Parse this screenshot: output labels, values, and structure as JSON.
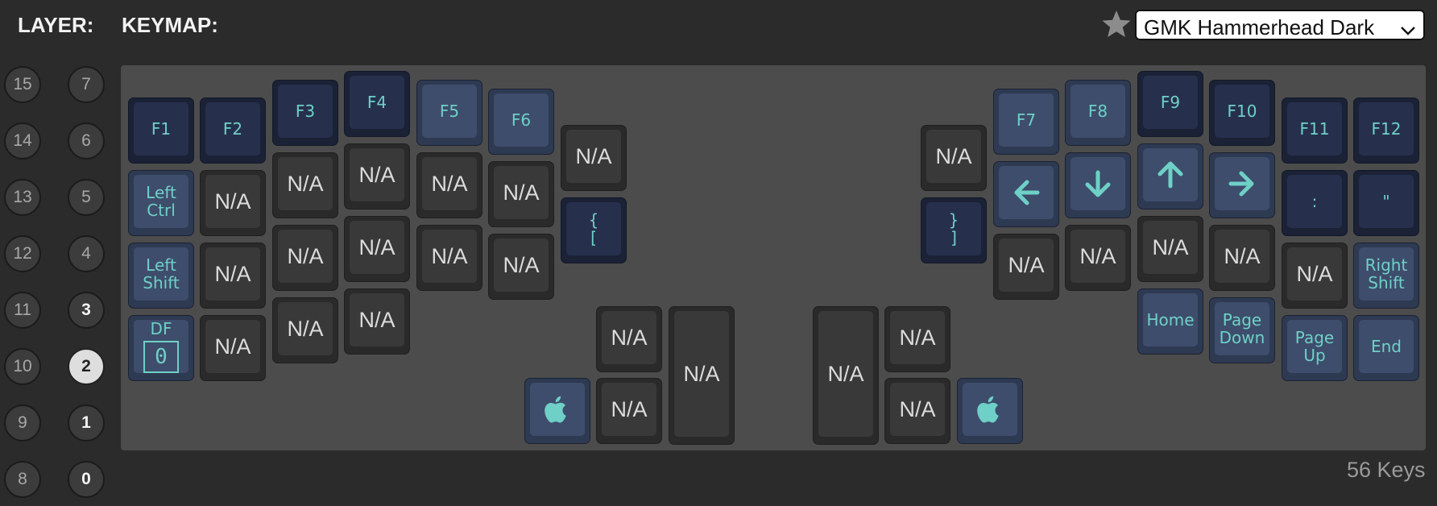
{
  "header": {
    "layer_label": "LAYER:",
    "keymap_label": "KEYMAP:",
    "favorite_icon": "star-icon",
    "theme_select": "GMK Hammerhead Dark"
  },
  "layers": [
    "15",
    "14",
    "13",
    "12",
    "11",
    "10",
    "9",
    "8",
    "7",
    "6",
    "5",
    "4",
    "3",
    "2",
    "1",
    "0"
  ],
  "selected_layer": "2",
  "footer": {
    "key_count": "56 Keys"
  },
  "keys": {
    "f1": "F1",
    "f2": "F2",
    "f3": "F3",
    "f4": "F4",
    "f5": "F5",
    "f6": "F6",
    "f7": "F7",
    "f8": "F8",
    "f9": "F9",
    "f10": "F10",
    "f11": "F11",
    "f12": "F12",
    "na": "N/A",
    "left_ctrl_1": "Left",
    "left_ctrl_2": "Ctrl",
    "left_shift_1": "Left",
    "left_shift_2": "Shift",
    "right_shift_1": "Right",
    "right_shift_2": "Shift",
    "df": "DF",
    "df_layer": "0",
    "lbrace_1": "{",
    "lbrace_2": "[",
    "rbrace_1": "}",
    "rbrace_2": "]",
    "colon": ":",
    "quote": "\"",
    "home": "Home",
    "pgdn_1": "Page",
    "pgdn_2": "Down",
    "pgup_1": "Page",
    "pgup_2": "Up",
    "end": "End",
    "arrow_left": "left-arrow-icon",
    "arrow_down": "down-arrow-icon",
    "arrow_up": "up-arrow-icon",
    "arrow_right": "right-arrow-icon",
    "gui_icon": "apple-icon"
  },
  "colors": {
    "legend": "#6ed0c6",
    "board": "#4c4c4c",
    "mod_key": "#3e4d6c",
    "dark_key": "#26304d",
    "na_key": "#393939"
  }
}
